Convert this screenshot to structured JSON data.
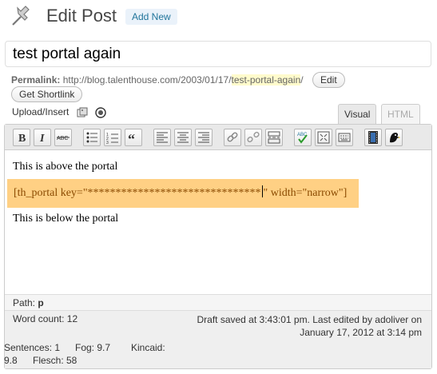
{
  "header": {
    "title": "Edit Post",
    "add_new": "Add New"
  },
  "post": {
    "title": "test portal again"
  },
  "permalink": {
    "label": "Permalink:",
    "url_prefix": "http://blog.talenthouse.com/2003/01/17/",
    "slug": "test-portal-again",
    "url_suffix": "/",
    "edit_label": "Edit",
    "shortlink_label": "Get Shortlink"
  },
  "media": {
    "upload_label": "Upload/Insert"
  },
  "tabs": {
    "visual": "Visual",
    "html": "HTML",
    "active": "Visual"
  },
  "toolbar": {
    "buttons": [
      "bold",
      "italic",
      "strikethrough",
      "bullet-list",
      "numbered-list",
      "blockquote",
      "align-left",
      "align-center",
      "align-right",
      "insert-link",
      "unlink",
      "insert-more",
      "spellcheck",
      "fullscreen",
      "kitchen-sink",
      "insert-video",
      "portal-plugin"
    ]
  },
  "content": {
    "line1": "This is above the portal",
    "portal_before_caret": "[th_portal key=\"*******************************",
    "portal_after_caret": "\" width=\"narrow\"]",
    "line3": "This is below the portal"
  },
  "path": {
    "label": "Path:",
    "value": "p"
  },
  "status": {
    "word_count": "Word count: 12",
    "draft_line1": "Draft saved at 3:43:01 pm. Last edited by adoliver on",
    "draft_line2": "January 17, 2012 at 3:14 pm"
  },
  "stats": {
    "sentences": "Sentences: 1",
    "fog": "Fog: 9.7",
    "kincaid_label": "Kincaid:",
    "kincaid_value": "9.8",
    "flesch": "Flesch: 58"
  },
  "colors": {
    "accent": "#21759b",
    "portal_highlight": "#ffd084",
    "slug_highlight": "#fffbcc"
  }
}
